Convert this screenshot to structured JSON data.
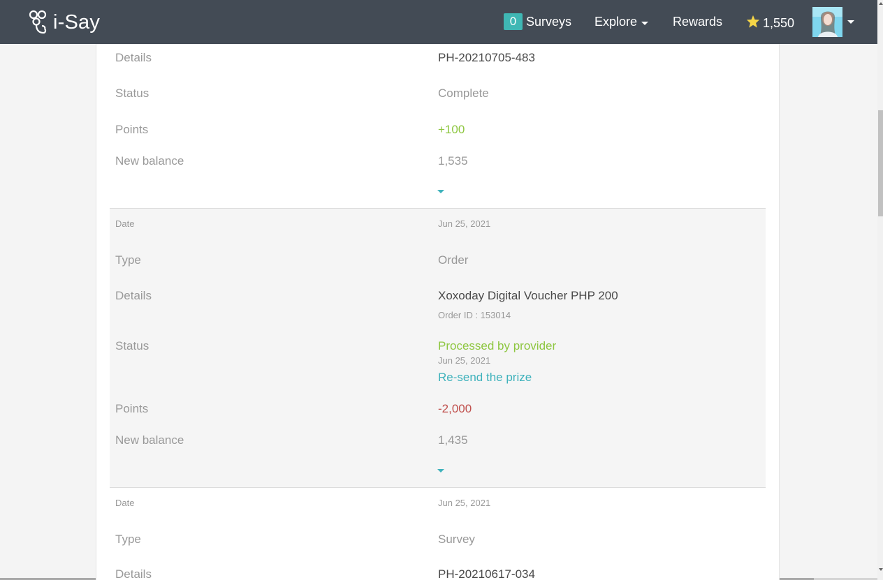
{
  "nav": {
    "brand": "i-Say",
    "surveys_count": "0",
    "surveys_label": "Surveys",
    "explore_label": "Explore",
    "rewards_label": "Rewards",
    "points_balance": "1,550",
    "icons": [
      "isay-logo-icon",
      "star-icon",
      "caret-down-icon",
      "avatar"
    ]
  },
  "labels": {
    "date": "Date",
    "type": "Type",
    "details": "Details",
    "status": "Status",
    "points": "Points",
    "new_balance": "New balance"
  },
  "transactions": [
    {
      "details": "PH-20210705-483",
      "status": "Complete",
      "points": "+100",
      "new_balance": "1,535"
    },
    {
      "date": "Jun 25, 2021",
      "type": "Order",
      "details": "Xoxoday Digital Voucher PHP 200",
      "order_id": "Order ID : 153014",
      "status": "Processed by provider",
      "status_date": "Jun 25, 2021",
      "resend_link": "Re-send the prize",
      "points": "-2,000",
      "new_balance": "1,435"
    },
    {
      "date": "Jun 25, 2021",
      "type": "Survey",
      "details": "PH-20210617-034"
    }
  ],
  "colors": {
    "navbar": "#434b55",
    "accent": "#3fb7b4",
    "positive": "#8dc63f",
    "negative": "#c0504d",
    "star": "#f5d547"
  }
}
